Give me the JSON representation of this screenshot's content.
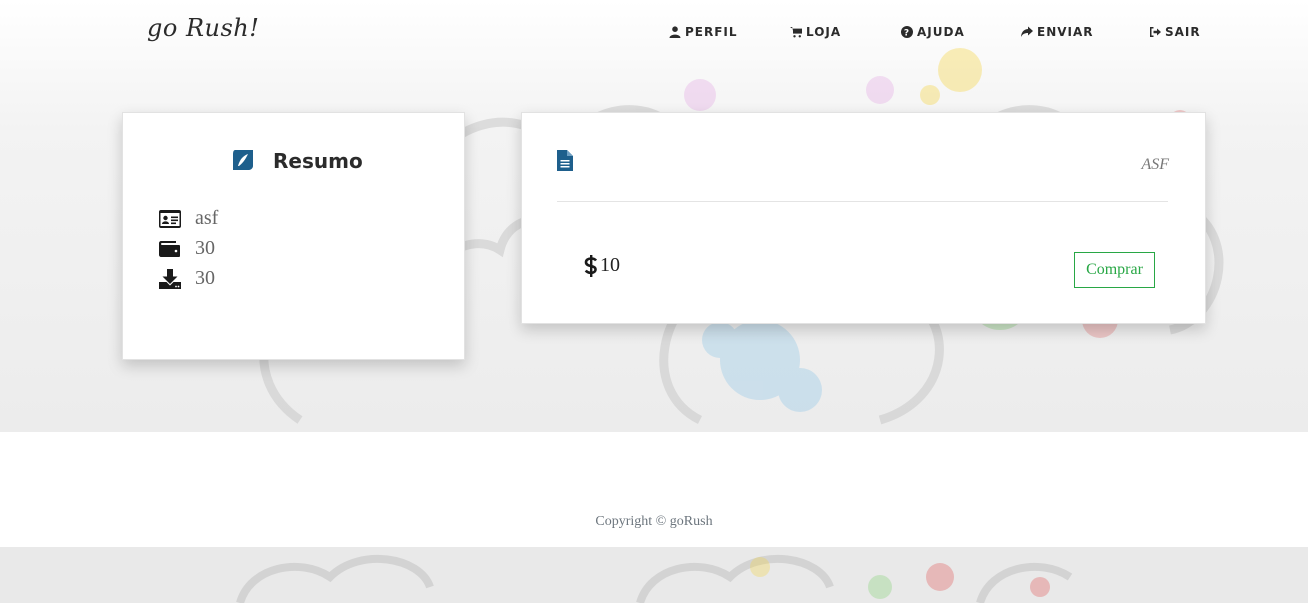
{
  "brand": "go Rush!",
  "nav": [
    {
      "label": "PERFIL",
      "icon": "user-icon"
    },
    {
      "label": "LOJA",
      "icon": "cart-icon"
    },
    {
      "label": "AJUDA",
      "icon": "question-icon"
    },
    {
      "label": "ENVIAR",
      "icon": "share-icon"
    },
    {
      "label": "SAIR",
      "icon": "sign-out-icon"
    }
  ],
  "summary": {
    "title": "Resumo",
    "icon": "leaf-icon",
    "rows": [
      {
        "icon": "id-card-icon",
        "value": "asf"
      },
      {
        "icon": "wallet-icon",
        "value": "30"
      },
      {
        "icon": "download-icon",
        "value": "30"
      }
    ]
  },
  "product": {
    "icon": "file-icon",
    "name": "ASF",
    "price_icon": "dollar-icon",
    "price": "10",
    "buy_label": "Comprar"
  },
  "footer": {
    "copyright": "Copyright © goRush"
  },
  "colors": {
    "accent_blue": "#1e5f8c",
    "buy_green": "#28a745",
    "text_dark": "#2b2b2b"
  }
}
